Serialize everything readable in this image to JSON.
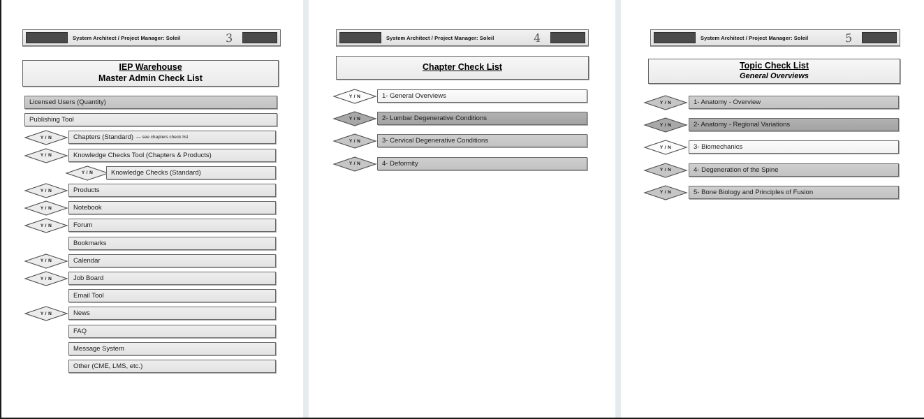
{
  "document": {
    "header_title": "System Architect / Project Manager: Soleil",
    "yn_label": "Y / N"
  },
  "pages": [
    {
      "page_number": "3",
      "title_line1": "IEP Warehouse",
      "title_line2": "Master Admin Check List",
      "rows": [
        {
          "label": "Licensed Users (Quantity)",
          "note": "",
          "shade": "med",
          "yn": false,
          "indent": 0
        },
        {
          "label": "Publishing Tool",
          "note": "",
          "shade": "light",
          "yn": false,
          "indent": 0
        },
        {
          "label": "Chapters (Standard)",
          "note": "— see chapters check list",
          "shade": "light",
          "yn": true,
          "indent": 1
        },
        {
          "label": "Knowledge Checks Tool (Chapters & Products)",
          "note": "",
          "shade": "light",
          "yn": true,
          "indent": 1
        },
        {
          "label": "Knowledge Checks (Standard)",
          "note": "",
          "shade": "light",
          "yn": true,
          "indent": 2
        },
        {
          "label": "Products",
          "note": "",
          "shade": "light",
          "yn": true,
          "indent": 1
        },
        {
          "label": "Notebook",
          "note": "",
          "shade": "light",
          "yn": true,
          "indent": 1
        },
        {
          "label": "Forum",
          "note": "",
          "shade": "light",
          "yn": true,
          "indent": 1
        },
        {
          "label": "Bookmarks",
          "note": "",
          "shade": "light",
          "yn": false,
          "indent": 1
        },
        {
          "label": "Calendar",
          "note": "",
          "shade": "light",
          "yn": true,
          "indent": 1
        },
        {
          "label": "Job Board",
          "note": "",
          "shade": "light",
          "yn": true,
          "indent": 1
        },
        {
          "label": "Email Tool",
          "note": "",
          "shade": "light",
          "yn": false,
          "indent": 1
        },
        {
          "label": "News",
          "note": "",
          "shade": "light",
          "yn": true,
          "indent": 1
        },
        {
          "label": "FAQ",
          "note": "",
          "shade": "light",
          "yn": false,
          "indent": 1
        },
        {
          "label": "Message System",
          "note": "",
          "shade": "light",
          "yn": false,
          "indent": 1
        },
        {
          "label": "Other (CME, LMS, etc.)",
          "note": "",
          "shade": "light",
          "yn": false,
          "indent": 1
        }
      ]
    },
    {
      "page_number": "4",
      "title_line1": "Chapter Check List",
      "title_line2": "",
      "rows": [
        {
          "label": "1- General Overviews",
          "note": "",
          "shade": "white",
          "yn": true,
          "indent": 1
        },
        {
          "label": "2- Lumbar Degenerative Conditions",
          "note": "",
          "shade": "dark",
          "yn": true,
          "indent": 1
        },
        {
          "label": "3- Cervical Degenerative Conditions",
          "note": "",
          "shade": "med",
          "yn": true,
          "indent": 1
        },
        {
          "label": "4- Deformity",
          "note": "",
          "shade": "med",
          "yn": true,
          "indent": 1
        }
      ]
    },
    {
      "page_number": "5",
      "title_line1": "Topic Check List",
      "title_line2": "General Overviews",
      "rows": [
        {
          "label": "1- Anatomy - Overview",
          "note": "",
          "shade": "med",
          "yn": true,
          "indent": 1
        },
        {
          "label": "2- Anatomy - Regional Variations",
          "note": "",
          "shade": "dark",
          "yn": true,
          "indent": 1
        },
        {
          "label": "3- Biomechanics",
          "note": "",
          "shade": "white",
          "yn": true,
          "indent": 1
        },
        {
          "label": "4- Degeneration of the Spine",
          "note": "",
          "shade": "med",
          "yn": true,
          "indent": 1
        },
        {
          "label": "5- Bone Biology and Principles of Fusion",
          "note": "",
          "shade": "med",
          "yn": true,
          "indent": 1
        }
      ]
    }
  ]
}
